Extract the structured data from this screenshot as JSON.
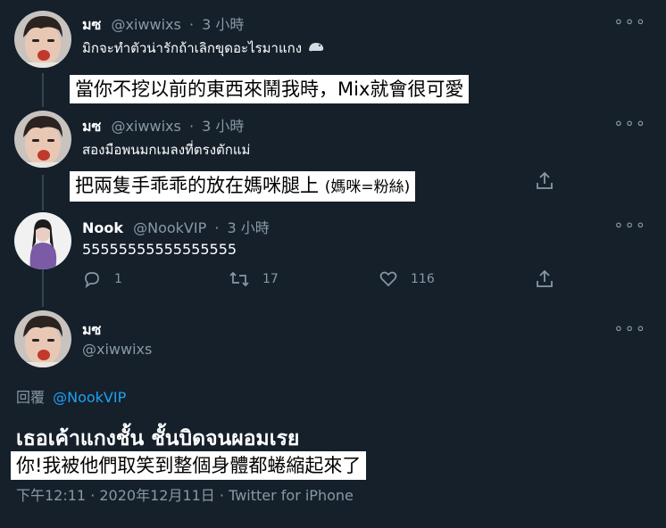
{
  "tweets": [
    {
      "name": "มซ",
      "handle": "@xiwwixs",
      "sep": "·",
      "time": "3 小時",
      "text": "มิกจะทำตัวน่ารักถ้าเลิกขุดอะไรมาแกง",
      "emoji": "seal-emoji",
      "caption": "當你不挖以前的東西來鬧我時，Mix就會很可愛"
    },
    {
      "name": "มซ",
      "handle": "@xiwwixs",
      "sep": "·",
      "time": "3 小時",
      "text": "สองมือพนมกเมลงที่ตรงตักแม่",
      "caption": "把兩隻手乖乖的放在媽咪腿上",
      "caption_note": "(媽咪=粉絲)"
    },
    {
      "name": "Nook",
      "handle": "@NookVIP",
      "sep": "·",
      "time": "3 小時",
      "text": "55555555555555555",
      "actions": {
        "reply_count": "1",
        "retweet_count": "17",
        "like_count": "116"
      }
    }
  ],
  "main": {
    "name": "มซ",
    "handle": "@xiwwixs",
    "reply_label": "回覆",
    "reply_handle": "@NookVIP",
    "text": "เธอเค้าแกงชั้น ชั้นบิดจนผอมเรย",
    "caption": "你!我被他們取笑到整個身體都蜷縮起來了",
    "timestamp": "下午12:11 · 2020年12月11日 · Twitter for iPhone"
  },
  "more_label": "∘∘∘",
  "colors": {
    "background": "#15202b",
    "secondary": "#8899a6",
    "link": "#1da1f2"
  }
}
